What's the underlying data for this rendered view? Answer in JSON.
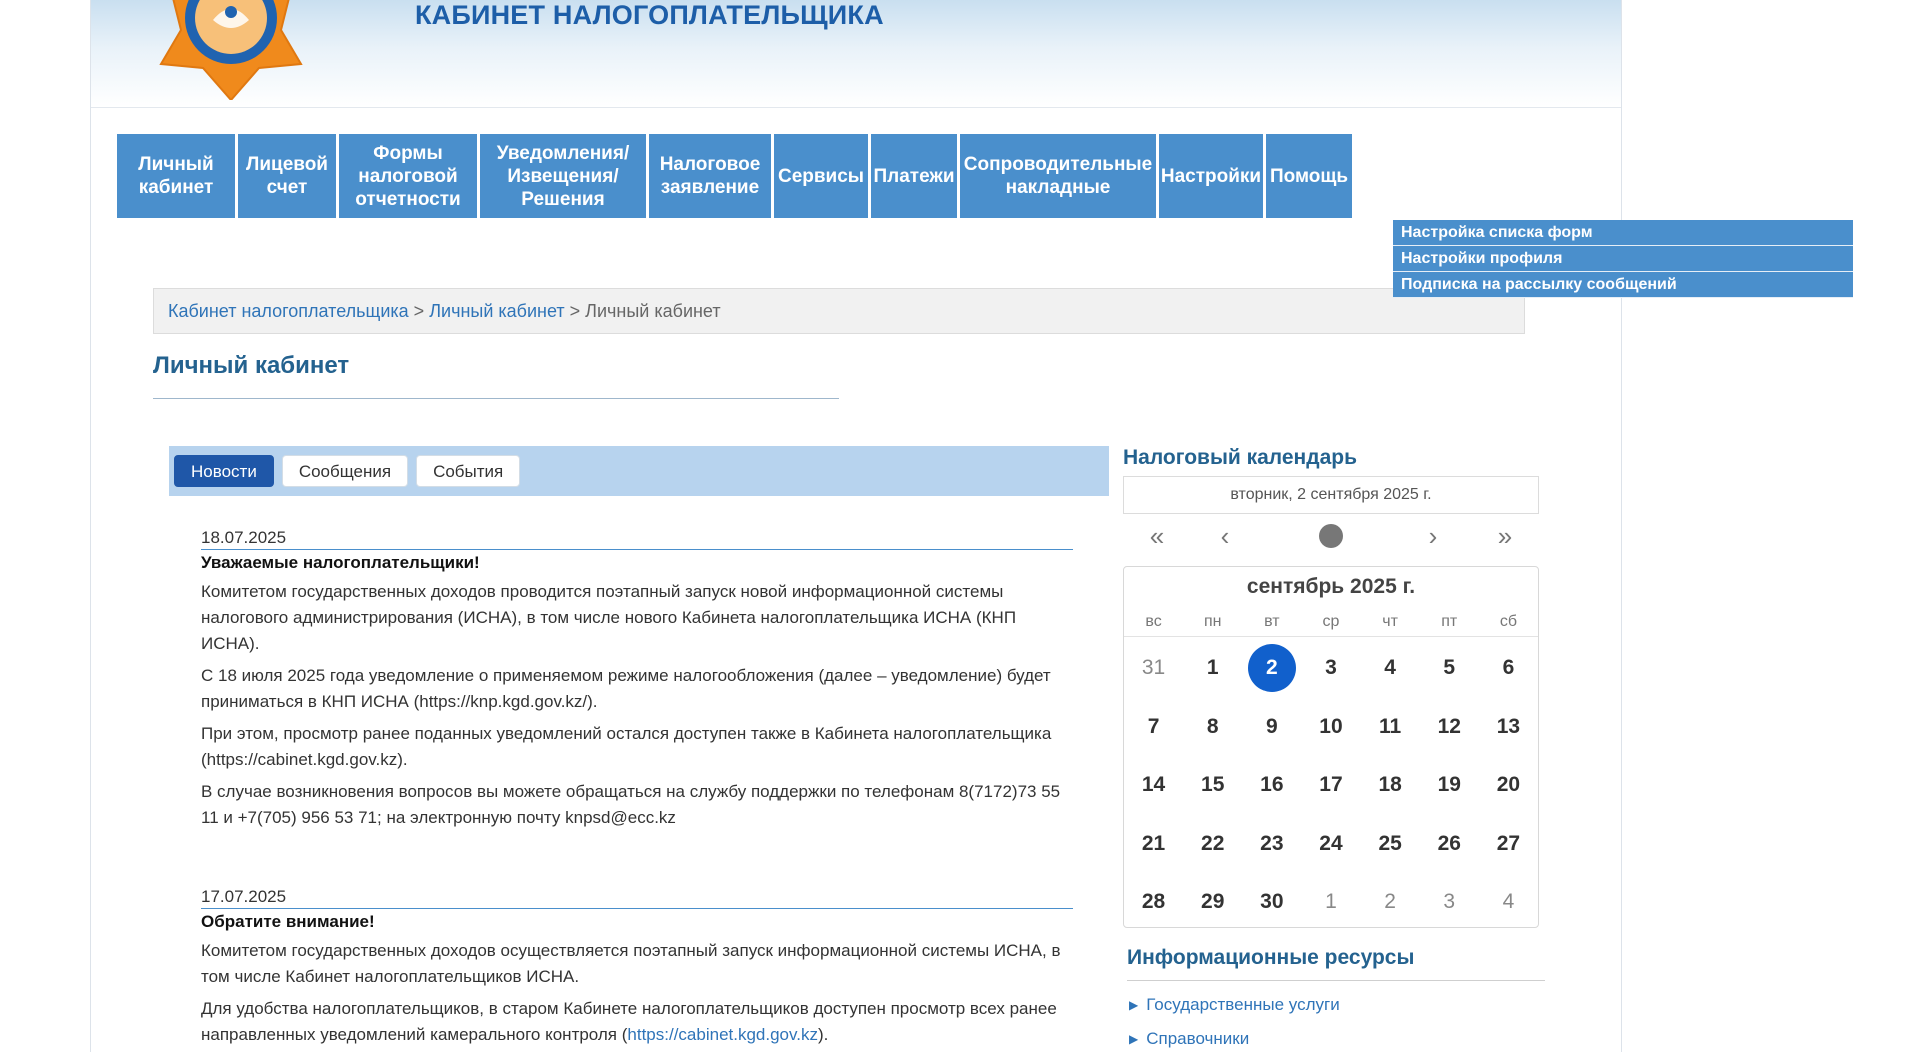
{
  "header": {
    "title": "КАБИНЕТ НАЛОГОПЛАТЕЛЬЩИКА",
    "colors": {
      "accent": "#4a8fcc",
      "title": "#1d5ea8",
      "today": "#1160cc"
    }
  },
  "nav": [
    {
      "label": "Личный\nкабинет"
    },
    {
      "label": "Лицевой\nсчет"
    },
    {
      "label": "Формы\nналоговой\nотчетности"
    },
    {
      "label": "Уведомления/\nИзвещения/\nРешения"
    },
    {
      "label": "Налоговое\nзаявление"
    },
    {
      "label": "Сервисы"
    },
    {
      "label": "Платежи"
    },
    {
      "label": "Сопроводительные\nнакладные"
    },
    {
      "label": "Настройки"
    },
    {
      "label": "Помощь"
    }
  ],
  "settings_menu": [
    {
      "label": "Настройка списка форм"
    },
    {
      "label": "Настройки профиля"
    },
    {
      "label": "Подписка на рассылку сообщений"
    }
  ],
  "breadcrumb": {
    "items": [
      "Кабинет налогоплательщика",
      "Личный кабинет",
      "Личный кабинет"
    ],
    "separator": ">"
  },
  "page_title": "Личный кабинет",
  "tabs": [
    {
      "label": "Новости",
      "active": true
    },
    {
      "label": "Сообщения",
      "active": false
    },
    {
      "label": "События",
      "active": false
    }
  ],
  "news": [
    {
      "date": "18.07.2025",
      "headline": "Уважаемые налогоплательщики!",
      "paragraphs": [
        "Комитетом государственных доходов проводится поэтапный запуск новой информационной системы налогового администрирования (ИСНА), в том числе нового Кабинета налогоплательщика ИСНА (КНП ИСНА).",
        "С 18 июля 2025 года уведомление о применяемом режиме налогообложения (далее – уведомление) будет приниматься в КНП ИСНА (https://knp.kgd.gov.kz/).",
        "При этом, просмотр ранее поданных уведомлений остался доступен также в Кабинета налогоплательщика (https://cabinet.kgd.gov.kz).",
        "В случае возникновения вопросов вы можете обращаться на службу поддержки по телефонам 8(7172)73 55 11 и +7(705) 956 53 71; на электронную почту knpsd@ecc.kz"
      ]
    },
    {
      "date": "17.07.2025",
      "headline": "Обратите внимание!",
      "paragraphs": [
        "Комитетом государственных доходов осуществляется поэтапный запуск информационной системы ИСНА, в том числе Кабинет налогоплательщиков ИСНА.",
        "Для удобства налогоплательщиков, в старом Кабинете налогоплательщиков доступен просмотр всех ранее направленных уведомлений камерального контроля ("
      ],
      "link": "https://cabinet.kgd.gov.kz",
      "link_suffix": ")."
    }
  ],
  "calendar": {
    "title": "Налоговый календарь",
    "current_date": "вторник, 2 сентября 2025 г.",
    "month_label": "сентябрь 2025 г.",
    "nav_icons": [
      "double-left-icon",
      "left-icon",
      "today-dot-icon",
      "right-icon",
      "double-right-icon"
    ],
    "weekdays": [
      "вс",
      "пн",
      "вт",
      "ср",
      "чт",
      "пт",
      "сб"
    ],
    "weeks": [
      [
        "31",
        "1",
        "2",
        "3",
        "4",
        "5",
        "6"
      ],
      [
        "7",
        "8",
        "9",
        "10",
        "11",
        "12",
        "13"
      ],
      [
        "14",
        "15",
        "16",
        "17",
        "18",
        "19",
        "20"
      ],
      [
        "21",
        "22",
        "23",
        "24",
        "25",
        "26",
        "27"
      ],
      [
        "28",
        "29",
        "30",
        "1",
        "2",
        "3",
        "4"
      ]
    ],
    "other_month": [
      [
        0,
        0
      ],
      [
        4,
        3
      ],
      [
        4,
        4
      ],
      [
        4,
        5
      ],
      [
        4,
        6
      ]
    ],
    "today": [
      0,
      2
    ]
  },
  "resources": {
    "title": "Информационные ресурсы",
    "links": [
      "Государственные услуги",
      "Справочники"
    ]
  }
}
